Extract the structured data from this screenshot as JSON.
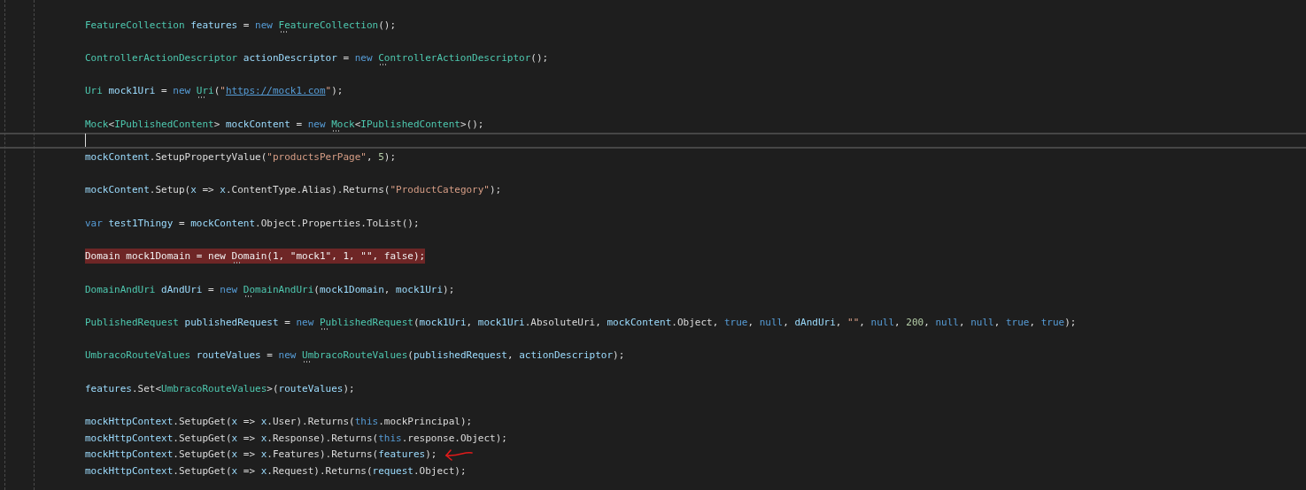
{
  "editor": {
    "lines": [
      {
        "kind": "blank"
      },
      {
        "kind": "code",
        "tokens": [
          {
            "kind": "type",
            "text": "FeatureCollection "
          },
          {
            "kind": "ident",
            "text": "features"
          },
          {
            "kind": "plain",
            "text": " = "
          },
          {
            "kind": "keyword",
            "text": "new "
          },
          {
            "kind": "type",
            "text": "FeatureCollection",
            "hint": true
          },
          {
            "kind": "plain",
            "text": "();"
          }
        ]
      },
      {
        "kind": "blank"
      },
      {
        "kind": "code",
        "tokens": [
          {
            "kind": "type",
            "text": "ControllerActionDescriptor "
          },
          {
            "kind": "ident",
            "text": "actionDescriptor"
          },
          {
            "kind": "plain",
            "text": " = "
          },
          {
            "kind": "keyword",
            "text": "new "
          },
          {
            "kind": "type",
            "text": "ControllerActionDescriptor",
            "hint": true
          },
          {
            "kind": "plain",
            "text": "();"
          }
        ]
      },
      {
        "kind": "blank"
      },
      {
        "kind": "code",
        "tokens": [
          {
            "kind": "type",
            "text": "Uri "
          },
          {
            "kind": "ident",
            "text": "mock1Uri"
          },
          {
            "kind": "plain",
            "text": " = "
          },
          {
            "kind": "keyword",
            "text": "new "
          },
          {
            "kind": "type",
            "text": "Uri",
            "hint": true
          },
          {
            "kind": "plain",
            "text": "("
          },
          {
            "kind": "string",
            "text": "\""
          },
          {
            "kind": "link",
            "text": "https://mock1.com"
          },
          {
            "kind": "string",
            "text": "\""
          },
          {
            "kind": "plain",
            "text": ");"
          }
        ]
      },
      {
        "kind": "blank"
      },
      {
        "kind": "code",
        "tokens": [
          {
            "kind": "type",
            "text": "Mock"
          },
          {
            "kind": "plain",
            "text": "<"
          },
          {
            "kind": "type",
            "text": "IPublishedContent"
          },
          {
            "kind": "plain",
            "text": "> "
          },
          {
            "kind": "ident",
            "text": "mockContent"
          },
          {
            "kind": "plain",
            "text": " = "
          },
          {
            "kind": "keyword",
            "text": "new "
          },
          {
            "kind": "type",
            "text": "Mock",
            "hint": true
          },
          {
            "kind": "plain",
            "text": "<"
          },
          {
            "kind": "type",
            "text": "IPublishedContent"
          },
          {
            "kind": "plain",
            "text": ">();"
          }
        ]
      },
      {
        "kind": "current"
      },
      {
        "kind": "code",
        "tokens": [
          {
            "kind": "ident",
            "text": "mockContent"
          },
          {
            "kind": "plain",
            "text": ".SetupPropertyValue("
          },
          {
            "kind": "string",
            "text": "\"productsPerPage\""
          },
          {
            "kind": "plain",
            "text": ", "
          },
          {
            "kind": "number",
            "text": "5"
          },
          {
            "kind": "plain",
            "text": ");"
          }
        ]
      },
      {
        "kind": "blank"
      },
      {
        "kind": "code",
        "tokens": [
          {
            "kind": "ident",
            "text": "mockContent"
          },
          {
            "kind": "plain",
            "text": ".Setup("
          },
          {
            "kind": "ident",
            "text": "x"
          },
          {
            "kind": "plain",
            "text": " => "
          },
          {
            "kind": "ident",
            "text": "x"
          },
          {
            "kind": "plain",
            "text": ".ContentType.Alias).Returns("
          },
          {
            "kind": "string",
            "text": "\"ProductCategory\""
          },
          {
            "kind": "plain",
            "text": ");"
          }
        ]
      },
      {
        "kind": "blank"
      },
      {
        "kind": "code",
        "tokens": [
          {
            "kind": "keyword",
            "text": "var "
          },
          {
            "kind": "ident",
            "text": "test1Thingy"
          },
          {
            "kind": "plain",
            "text": " = "
          },
          {
            "kind": "ident",
            "text": "mockContent"
          },
          {
            "kind": "plain",
            "text": ".Object.Properties.ToList();"
          }
        ]
      },
      {
        "kind": "blank"
      },
      {
        "kind": "error",
        "tokens": [
          {
            "kind": "plain",
            "text": "Domain mock1Domain = new "
          },
          {
            "kind": "plain",
            "text": "Domain",
            "hint": true
          },
          {
            "kind": "plain",
            "text": "(1, \"mock1\", 1, \"\", false);"
          }
        ]
      },
      {
        "kind": "blank"
      },
      {
        "kind": "code",
        "tokens": [
          {
            "kind": "type",
            "text": "DomainAndUri "
          },
          {
            "kind": "ident",
            "text": "dAndUri"
          },
          {
            "kind": "plain",
            "text": " = "
          },
          {
            "kind": "keyword",
            "text": "new "
          },
          {
            "kind": "type",
            "text": "DomainAndUri",
            "hint": true
          },
          {
            "kind": "plain",
            "text": "("
          },
          {
            "kind": "ident",
            "text": "mock1Domain"
          },
          {
            "kind": "plain",
            "text": ", "
          },
          {
            "kind": "ident",
            "text": "mock1Uri"
          },
          {
            "kind": "plain",
            "text": ");"
          }
        ]
      },
      {
        "kind": "blank"
      },
      {
        "kind": "code",
        "tokens": [
          {
            "kind": "type",
            "text": "PublishedRequest "
          },
          {
            "kind": "ident",
            "text": "publishedRequest"
          },
          {
            "kind": "plain",
            "text": " = "
          },
          {
            "kind": "keyword",
            "text": "new "
          },
          {
            "kind": "type",
            "text": "PublishedRequest",
            "hint": true
          },
          {
            "kind": "plain",
            "text": "("
          },
          {
            "kind": "ident",
            "text": "mock1Uri"
          },
          {
            "kind": "plain",
            "text": ", "
          },
          {
            "kind": "ident",
            "text": "mock1Uri"
          },
          {
            "kind": "plain",
            "text": ".AbsoluteUri, "
          },
          {
            "kind": "ident",
            "text": "mockContent"
          },
          {
            "kind": "plain",
            "text": ".Object, "
          },
          {
            "kind": "keyword",
            "text": "true"
          },
          {
            "kind": "plain",
            "text": ", "
          },
          {
            "kind": "keyword",
            "text": "null"
          },
          {
            "kind": "plain",
            "text": ", "
          },
          {
            "kind": "ident",
            "text": "dAndUri"
          },
          {
            "kind": "plain",
            "text": ", "
          },
          {
            "kind": "string",
            "text": "\"\""
          },
          {
            "kind": "plain",
            "text": ", "
          },
          {
            "kind": "keyword",
            "text": "null"
          },
          {
            "kind": "plain",
            "text": ", "
          },
          {
            "kind": "number",
            "text": "200"
          },
          {
            "kind": "plain",
            "text": ", "
          },
          {
            "kind": "keyword",
            "text": "null"
          },
          {
            "kind": "plain",
            "text": ", "
          },
          {
            "kind": "keyword",
            "text": "null"
          },
          {
            "kind": "plain",
            "text": ", "
          },
          {
            "kind": "keyword",
            "text": "true"
          },
          {
            "kind": "plain",
            "text": ", "
          },
          {
            "kind": "keyword",
            "text": "true"
          },
          {
            "kind": "plain",
            "text": ");"
          }
        ]
      },
      {
        "kind": "blank"
      },
      {
        "kind": "code",
        "tokens": [
          {
            "kind": "type",
            "text": "UmbracoRouteValues "
          },
          {
            "kind": "ident",
            "text": "routeValues"
          },
          {
            "kind": "plain",
            "text": " = "
          },
          {
            "kind": "keyword",
            "text": "new "
          },
          {
            "kind": "type",
            "text": "UmbracoRouteValues",
            "hint": true
          },
          {
            "kind": "plain",
            "text": "("
          },
          {
            "kind": "ident",
            "text": "publishedRequest"
          },
          {
            "kind": "plain",
            "text": ", "
          },
          {
            "kind": "ident",
            "text": "actionDescriptor"
          },
          {
            "kind": "plain",
            "text": ");"
          }
        ]
      },
      {
        "kind": "blank"
      },
      {
        "kind": "code",
        "tokens": [
          {
            "kind": "ident",
            "text": "features"
          },
          {
            "kind": "plain",
            "text": ".Set<"
          },
          {
            "kind": "type",
            "text": "UmbracoRouteValues"
          },
          {
            "kind": "plain",
            "text": ">("
          },
          {
            "kind": "ident",
            "text": "routeValues"
          },
          {
            "kind": "plain",
            "text": ");"
          }
        ]
      },
      {
        "kind": "blank"
      },
      {
        "kind": "code",
        "tokens": [
          {
            "kind": "ident",
            "text": "mockHttpContext"
          },
          {
            "kind": "plain",
            "text": ".SetupGet("
          },
          {
            "kind": "ident",
            "text": "x"
          },
          {
            "kind": "plain",
            "text": " => "
          },
          {
            "kind": "ident",
            "text": "x"
          },
          {
            "kind": "plain",
            "text": ".User).Returns("
          },
          {
            "kind": "keyword",
            "text": "this"
          },
          {
            "kind": "plain",
            "text": ".mockPrincipal);"
          }
        ]
      },
      {
        "kind": "code",
        "tokens": [
          {
            "kind": "ident",
            "text": "mockHttpContext"
          },
          {
            "kind": "plain",
            "text": ".SetupGet("
          },
          {
            "kind": "ident",
            "text": "x"
          },
          {
            "kind": "plain",
            "text": " => "
          },
          {
            "kind": "ident",
            "text": "x"
          },
          {
            "kind": "plain",
            "text": ".Response).Returns("
          },
          {
            "kind": "keyword",
            "text": "this"
          },
          {
            "kind": "plain",
            "text": ".response.Object);"
          }
        ]
      },
      {
        "kind": "code",
        "arrow_marker": true,
        "tokens": [
          {
            "kind": "ident",
            "text": "mockHttpContext"
          },
          {
            "kind": "plain",
            "text": ".SetupGet("
          },
          {
            "kind": "ident",
            "text": "x"
          },
          {
            "kind": "plain",
            "text": " => "
          },
          {
            "kind": "ident",
            "text": "x"
          },
          {
            "kind": "plain",
            "text": ".Features).Returns("
          },
          {
            "kind": "ident",
            "text": "features"
          },
          {
            "kind": "plain",
            "text": ");"
          }
        ]
      },
      {
        "kind": "code",
        "tokens": [
          {
            "kind": "ident",
            "text": "mockHttpContext"
          },
          {
            "kind": "plain",
            "text": ".SetupGet("
          },
          {
            "kind": "ident",
            "text": "x"
          },
          {
            "kind": "plain",
            "text": " => "
          },
          {
            "kind": "ident",
            "text": "x"
          },
          {
            "kind": "plain",
            "text": ".Request).Returns("
          },
          {
            "kind": "ident",
            "text": "request"
          },
          {
            "kind": "plain",
            "text": ".Object);"
          }
        ]
      }
    ]
  }
}
